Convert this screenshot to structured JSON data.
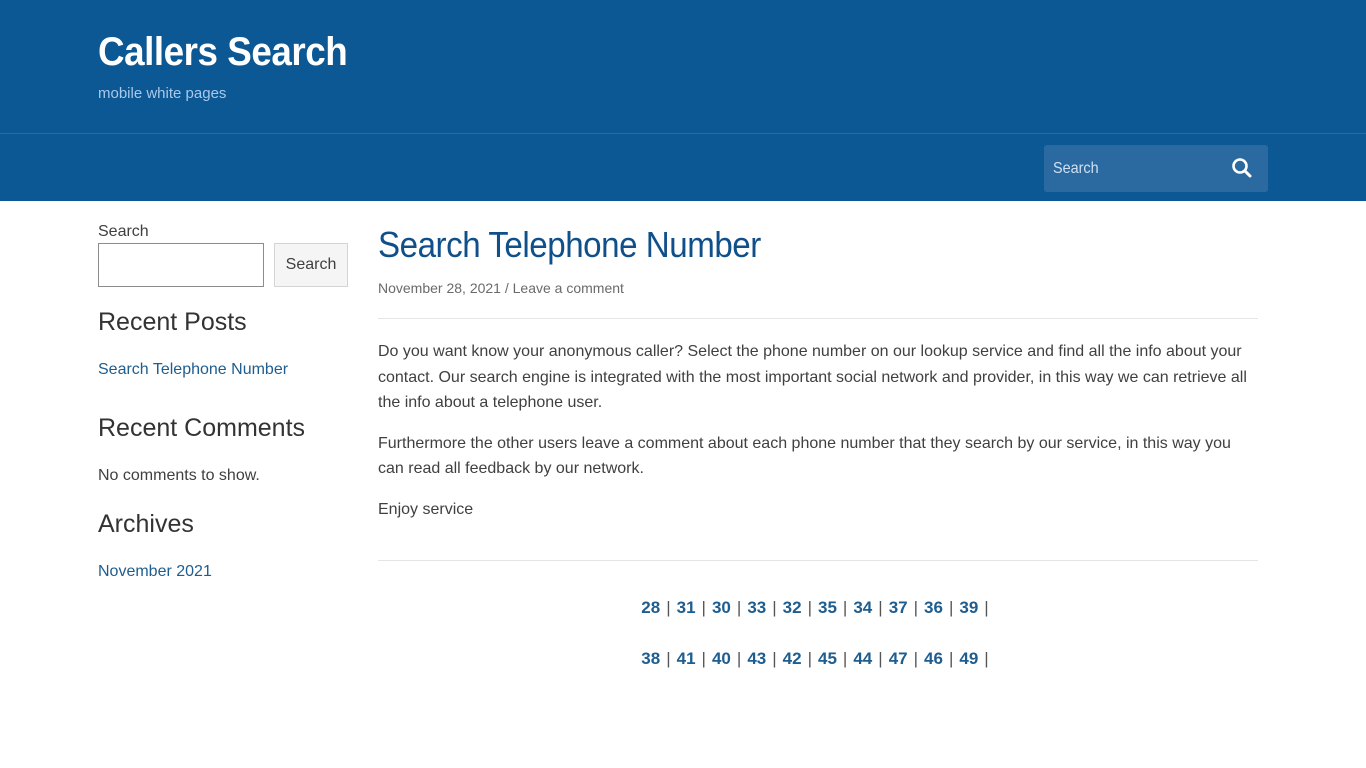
{
  "header": {
    "site_title": "Callers Search",
    "tagline": "mobile white pages"
  },
  "nav": {
    "search_placeholder": "Search",
    "search_icon": "search-icon"
  },
  "sidebar": {
    "search_label": "Search",
    "search_value": "",
    "search_button": "Search",
    "recent_posts": {
      "heading": "Recent Posts",
      "items": [
        "Search Telephone Number"
      ]
    },
    "recent_comments": {
      "heading": "Recent Comments",
      "empty_text": "No comments to show."
    },
    "archives": {
      "heading": "Archives",
      "items": [
        "November 2021"
      ]
    }
  },
  "post": {
    "title": "Search Telephone Number",
    "date": "November 28, 2021",
    "meta_separator": "/",
    "comment_link": "Leave a comment",
    "paragraphs": [
      "Do you want know your anonymous caller? Select the phone number on our lookup service and find all the info about your contact. Our search engine is integrated with the most important social network and provider, in this way we can retrieve all the info about a telephone user.",
      "Furthermore the other users leave a comment about each phone number that they search by our service, in this way you can read all feedback by our network.",
      "Enjoy service"
    ]
  },
  "pagination": {
    "rows": [
      [
        "28",
        "31",
        "30",
        "33",
        "32",
        "35",
        "34",
        "37",
        "36",
        "39"
      ],
      [
        "38",
        "41",
        "40",
        "43",
        "42",
        "45",
        "44",
        "47",
        "46",
        "49"
      ]
    ],
    "separator": "|"
  },
  "colors": {
    "header_bg": "#0c5895",
    "nav_search_bg": "#2a6aa1",
    "title_color": "#0f4f8a",
    "link_color": "#1e5d8f"
  }
}
